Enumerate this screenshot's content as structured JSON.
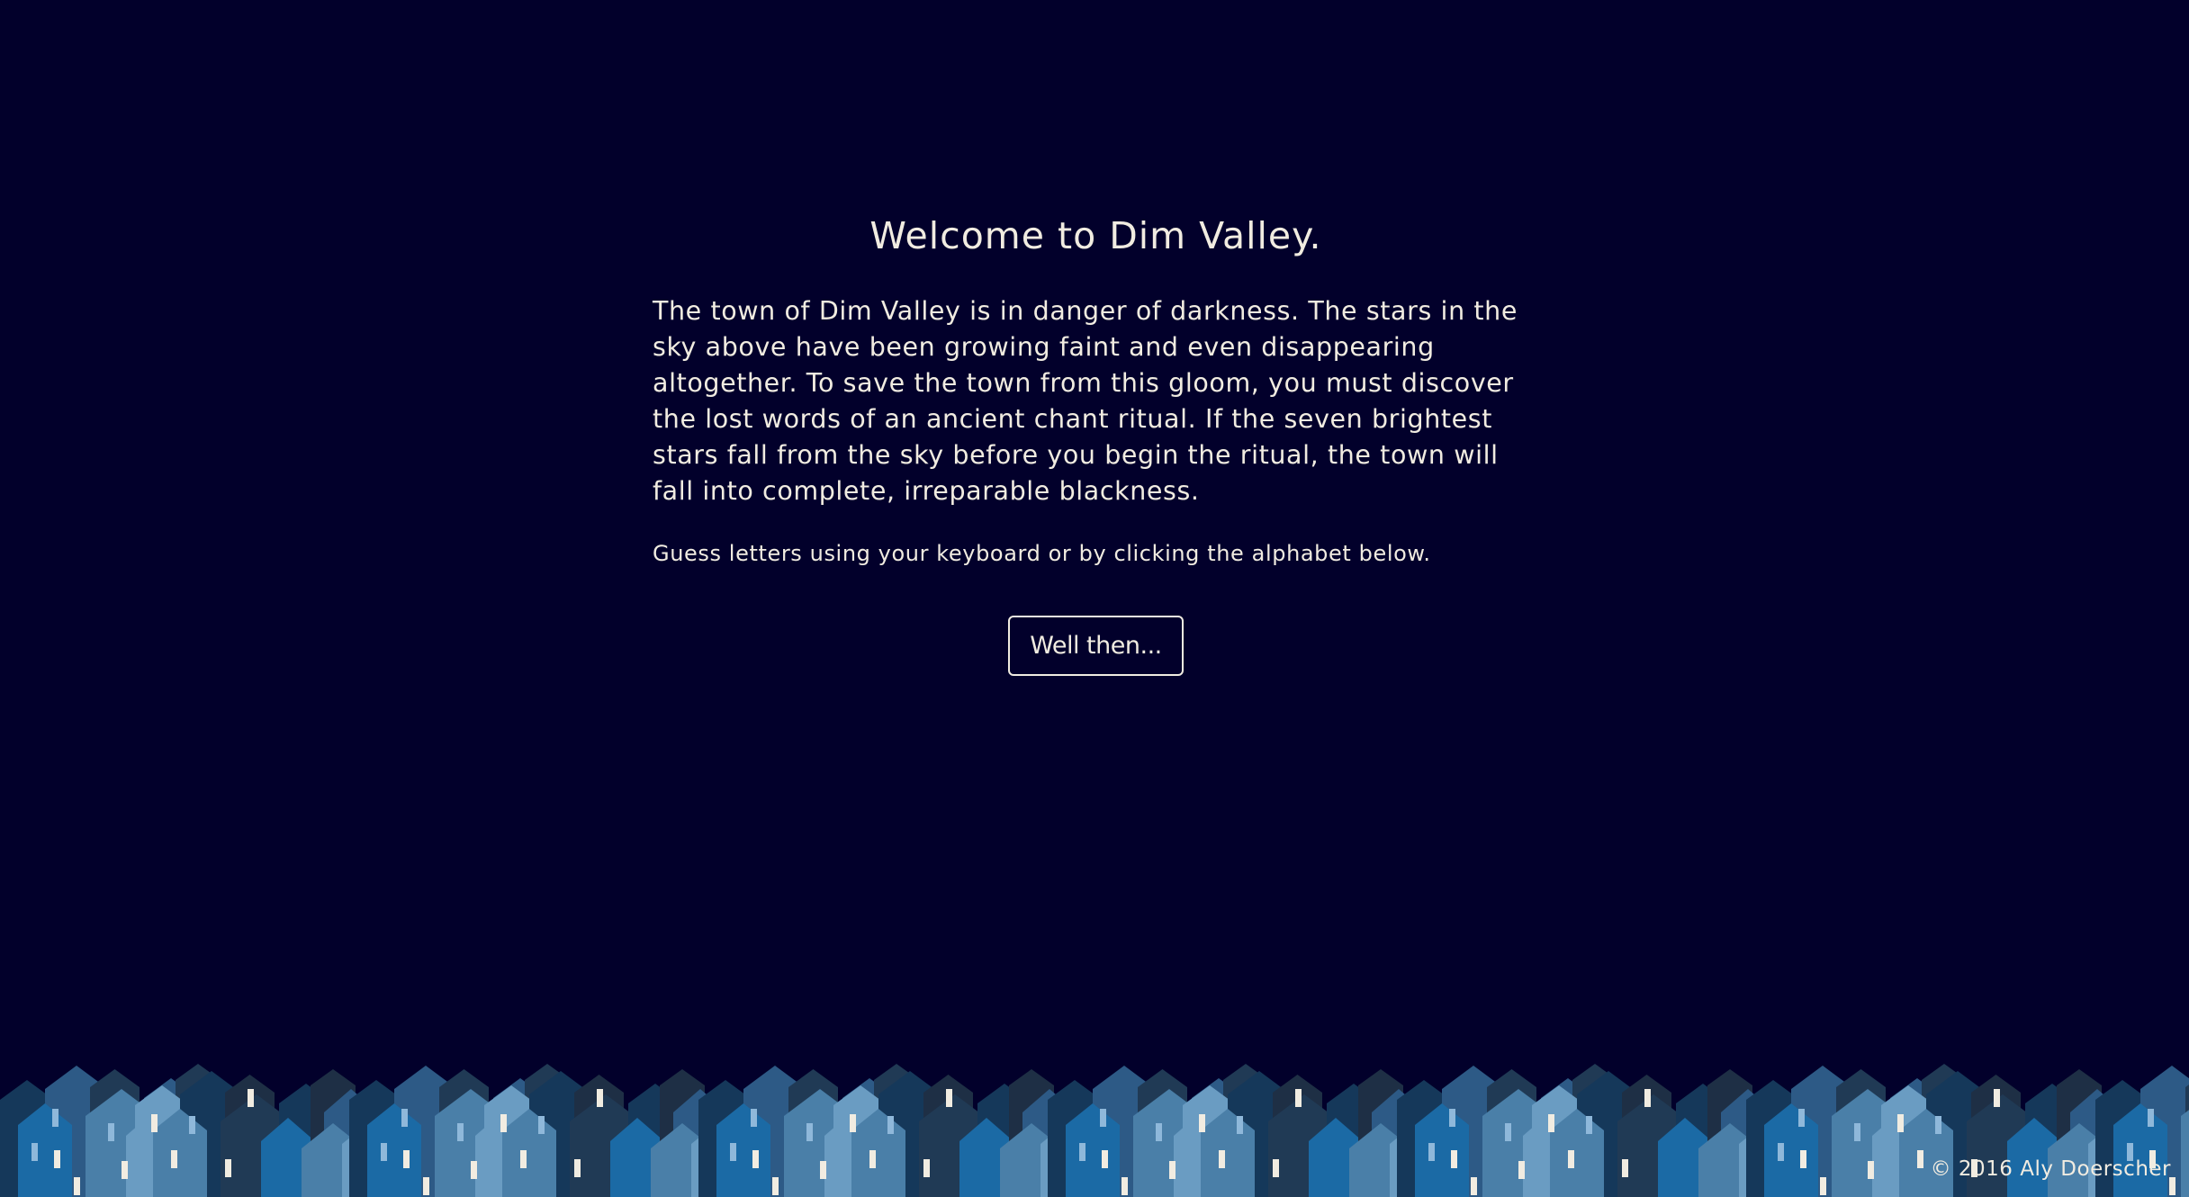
{
  "intro": {
    "title": "Welcome to Dim Valley.",
    "story": "The town of Dim Valley is in danger of darkness. The stars in the sky above have been growing faint and even disappearing altogether. To save the town from this gloom, you must discover the lost words of an ancient chant ritual. If the seven brightest stars fall from the sky before you begin the ritual, the town will fall into complete, irreparable blackness.",
    "hint": "Guess letters using your keyboard or by clicking the alphabet below.",
    "button_label": "Well then..."
  },
  "footer": {
    "copyright": "© 2016 Aly Doerscher"
  },
  "colors": {
    "background": "#02002b",
    "text": "#f1ece1",
    "house_palette": [
      "#1b6aa5",
      "#2d5a86",
      "#4a7fa8",
      "#15385a",
      "#203a55",
      "#6a9cc2",
      "#1e2f45"
    ],
    "window_light": "#f1ece1",
    "window_blue": "#8fb8da"
  },
  "icons": {
    "town_illustration": "town-skyline-icon"
  }
}
